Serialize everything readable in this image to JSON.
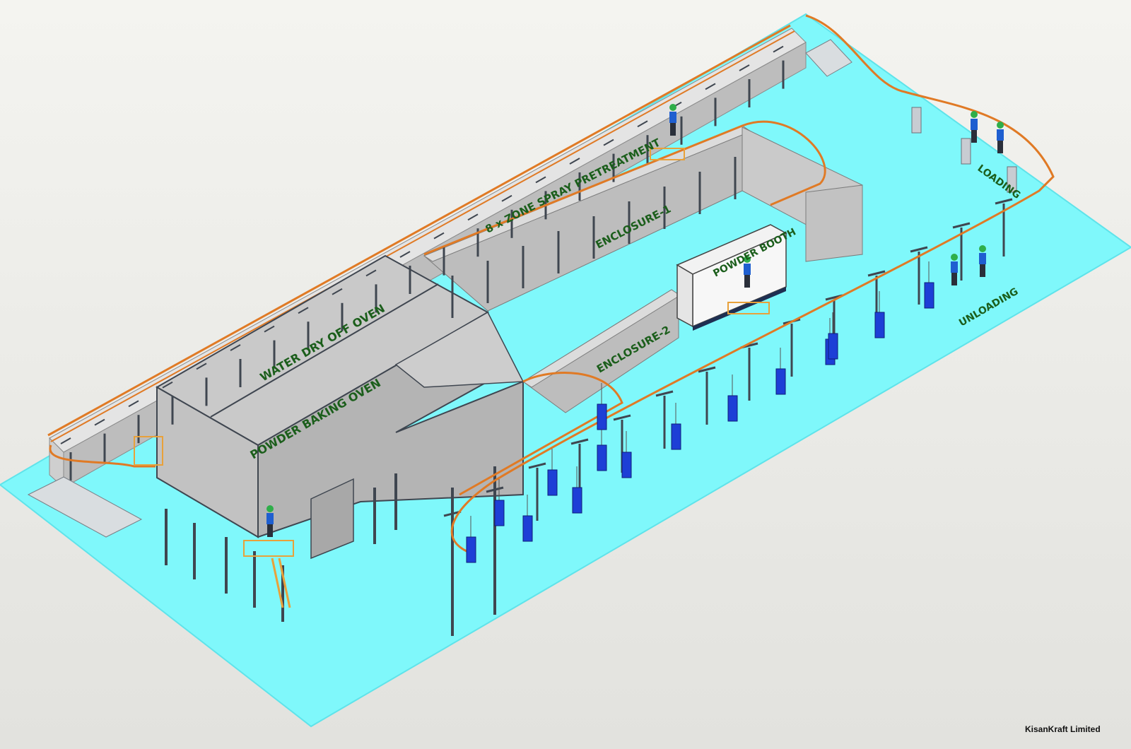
{
  "colors": {
    "floor": "#7ff8fb",
    "floor_edge": "#5fe3ea",
    "background": "#ecece8",
    "structure_light": "#d4d4d4",
    "structure_side": "#bdbdbd",
    "structure_dark": "#9a9a9a",
    "frame": "#3f4650",
    "conveyor": "#e07a25",
    "parts": "#1d3fd6",
    "label": "#1b5e1b",
    "platform": "#e8a13a"
  },
  "labels": {
    "pretreatment": "8 x ZONE SPRAY PRETREATMENT",
    "enclosure1": "ENCLOSURE-1",
    "enclosure2": "ENCLOSURE-2",
    "powder_booth": "POWDER BOOTH",
    "water_dry_off_oven": "WATER DRY OFF OVEN",
    "powder_baking_oven": "POWDER BAKING OVEN",
    "loading": "LOADING",
    "unloading": "UNLOADING"
  },
  "credit": "KisanKraft Limited"
}
